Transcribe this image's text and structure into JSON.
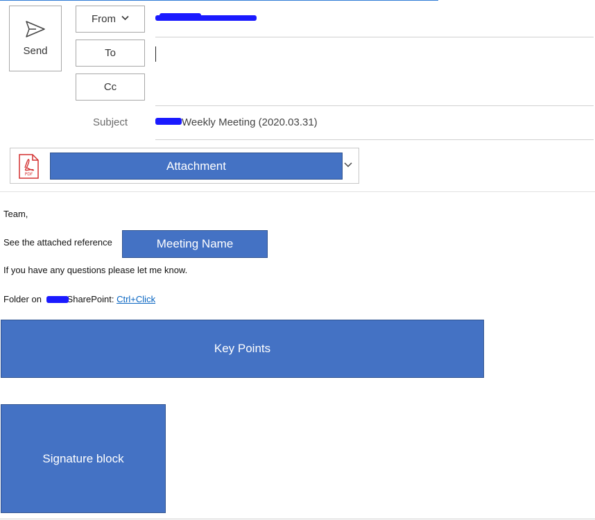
{
  "header": {
    "send_label": "Send",
    "from_label": "From",
    "to_label": "To",
    "cc_label": "Cc",
    "subject_label": "Subject",
    "subject_value": "Weekly Meeting (2020.03.31)",
    "to_value": "",
    "cc_value": ""
  },
  "attachment": {
    "label": "Attachment",
    "icon": "pdf-icon",
    "icon_text": "PDF"
  },
  "body": {
    "greeting": "Team,",
    "reference_text": "See the attached reference",
    "meeting_name": "Meeting Name",
    "questions_text": "If you have any questions please let me know.",
    "folder_prefix": "Folder on",
    "folder_suffix": "SharePoint: ",
    "link_text": "Ctrl+Click",
    "key_points": "Key Points",
    "signature": "Signature block"
  },
  "colors": {
    "placeholder_fill": "#4472c4",
    "placeholder_border": "#2f528f",
    "focus_line": "#2d7ad6",
    "link": "#0563c1",
    "redaction": "#1a1aff",
    "pdf_red": "#d32f2f"
  }
}
